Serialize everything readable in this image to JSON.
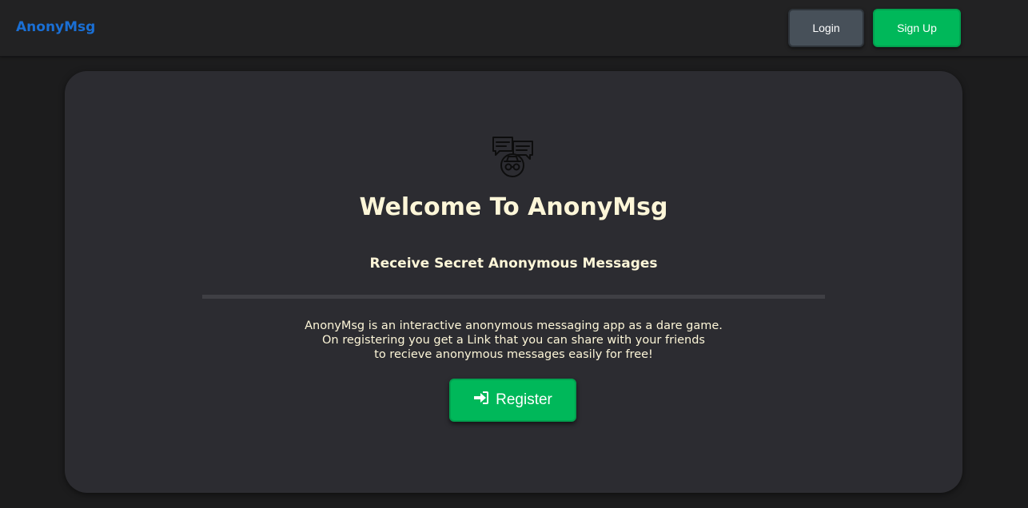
{
  "navbar": {
    "brand": "AnonyMsg",
    "login_label": "Login",
    "signup_label": "Sign Up"
  },
  "hero": {
    "icon": "anonymous-chat-icon",
    "title": "Welcome To AnonyMsg",
    "subtitle": "Receive Secret Anonymous Messages",
    "description_lines": [
      "AnonyMsg is an interactive anonymous messaging app as a dare game.",
      "On registering you get a Link that you can share with your friends",
      "to recieve anonymous messages easily for free!"
    ],
    "register_label": "Register",
    "register_icon": "sign-in-icon"
  },
  "colors": {
    "brand": "#1a6fd4",
    "accent_green": "#00b85a",
    "login_gray": "#475059",
    "card_bg": "#2c2c31",
    "text_cream": "#fdf6d8"
  }
}
